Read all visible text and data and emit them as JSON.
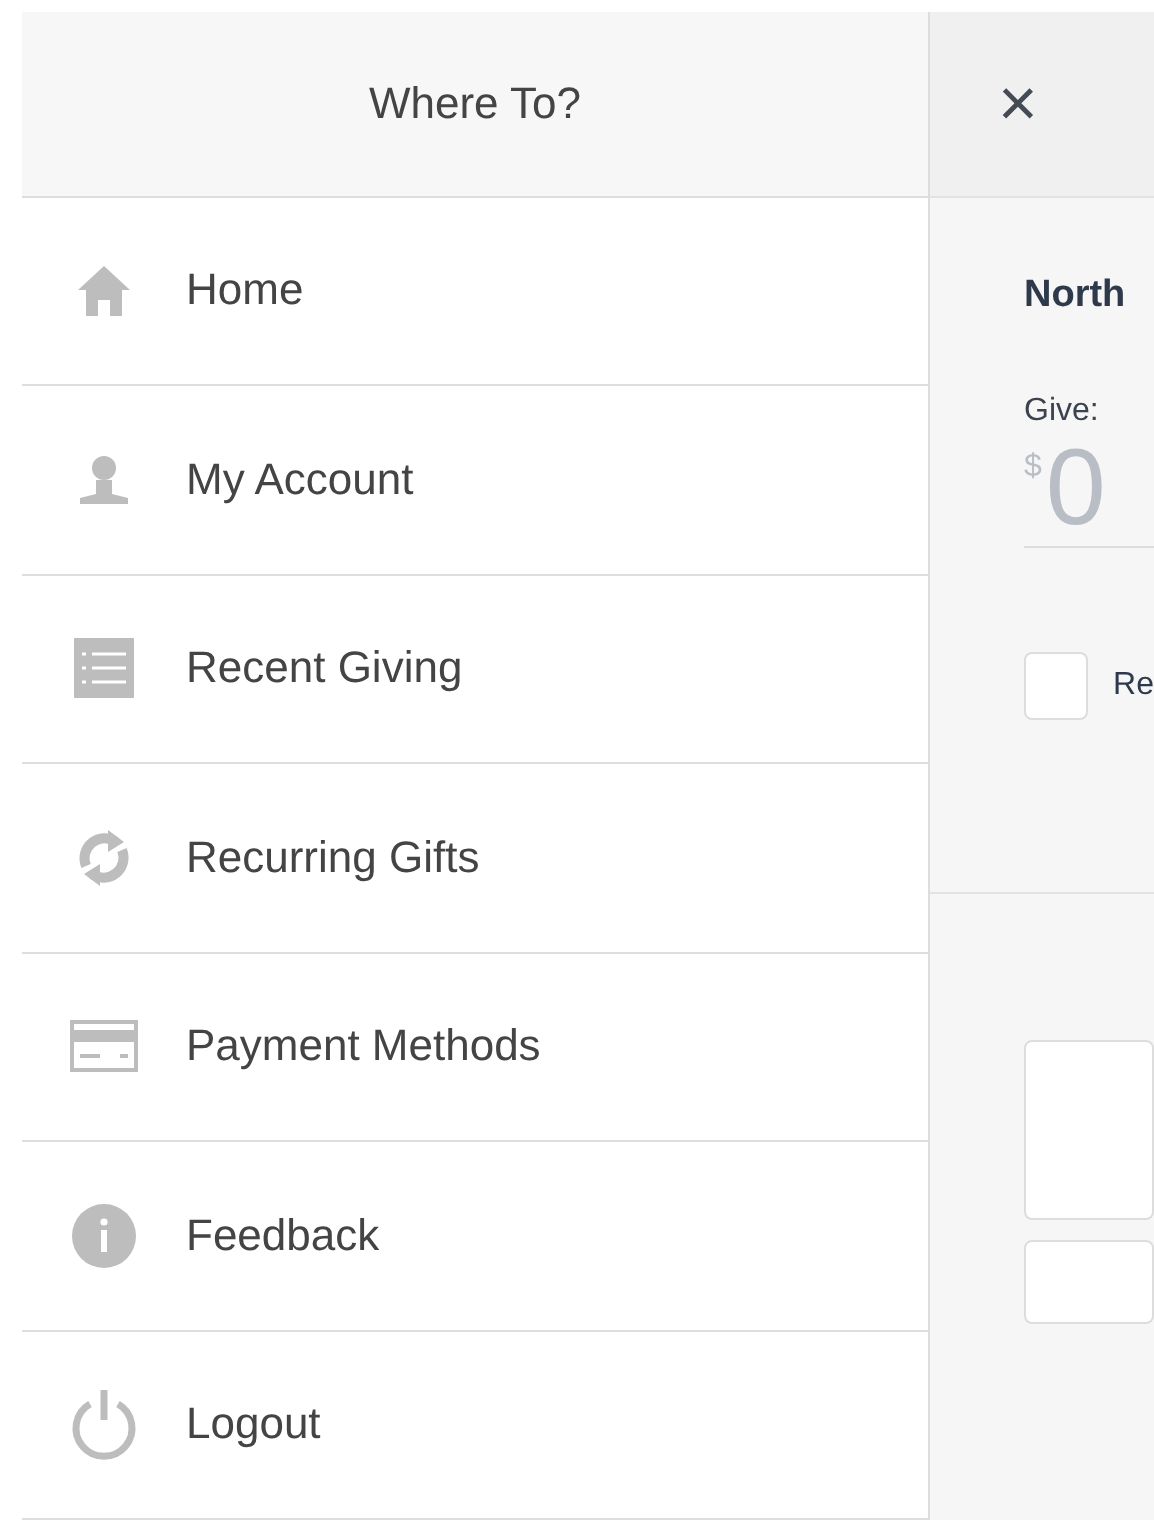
{
  "menu": {
    "title": "Where To?",
    "items": [
      {
        "label": "Home",
        "kind": "home"
      },
      {
        "label": "My Account",
        "kind": "account"
      },
      {
        "label": "Recent Giving",
        "kind": "list"
      },
      {
        "label": "Recurring Gifts",
        "kind": "recurring"
      },
      {
        "label": "Payment Methods",
        "kind": "card"
      },
      {
        "label": "Feedback",
        "kind": "info"
      },
      {
        "label": "Logout",
        "kind": "power"
      }
    ]
  },
  "panel": {
    "close": "×",
    "org": "North",
    "give_label": "Give:",
    "currency": "$",
    "amount": "0",
    "recurring": {
      "label": "Re",
      "checked": false
    }
  }
}
